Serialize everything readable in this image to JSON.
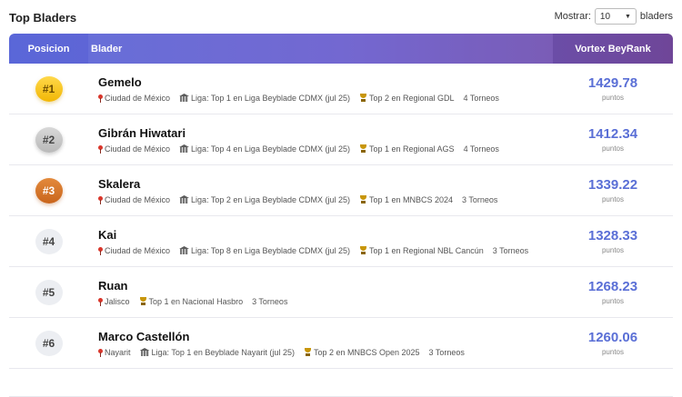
{
  "header": {
    "title": "Top Bladers",
    "show_label": "Mostrar:",
    "show_value": "10",
    "show_suffix": "bladers"
  },
  "table": {
    "col_position": "Posicion",
    "col_blader": "Blader",
    "col_rank": "Vortex BeyRank",
    "points_label": "puntos"
  },
  "rows": [
    {
      "rank": "#1",
      "name": "Gemelo",
      "location": "Ciudad de México",
      "league": "Liga: Top 1 en Liga Beyblade CDMX (jul 25)",
      "achievement": "Top 2 en Regional GDL",
      "tournaments": "4 Torneos",
      "score": "1429.78"
    },
    {
      "rank": "#2",
      "name": "Gibrán Hiwatari",
      "location": "Ciudad de México",
      "league": "Liga: Top 4 en Liga Beyblade CDMX (jul 25)",
      "achievement": "Top 1 en Regional AGS",
      "tournaments": "4 Torneos",
      "score": "1412.34"
    },
    {
      "rank": "#3",
      "name": "Skalera",
      "location": "Ciudad de México",
      "league": "Liga: Top 2 en Liga Beyblade CDMX (jul 25)",
      "achievement": "Top 1 en MNBCS 2024",
      "tournaments": "3 Torneos",
      "score": "1339.22"
    },
    {
      "rank": "#4",
      "name": "Kai",
      "location": "Ciudad de México",
      "league": "Liga: Top 8 en Liga Beyblade CDMX (jul 25)",
      "achievement": "Top 1 en Regional NBL Cancún",
      "tournaments": "3 Torneos",
      "score": "1328.33"
    },
    {
      "rank": "#5",
      "name": "Ruan",
      "location": "Jalisco",
      "league": "",
      "achievement": "Top 1 en Nacional Hasbro",
      "tournaments": "3 Torneos",
      "score": "1268.23"
    },
    {
      "rank": "#6",
      "name": "Marco Castellón",
      "location": "Nayarit",
      "league": "Liga: Top 1 en Beyblade Nayarit (jul 25)",
      "achievement": "Top 2 en MNBCS Open 2025",
      "tournaments": "3 Torneos",
      "score": "1260.06"
    }
  ]
}
